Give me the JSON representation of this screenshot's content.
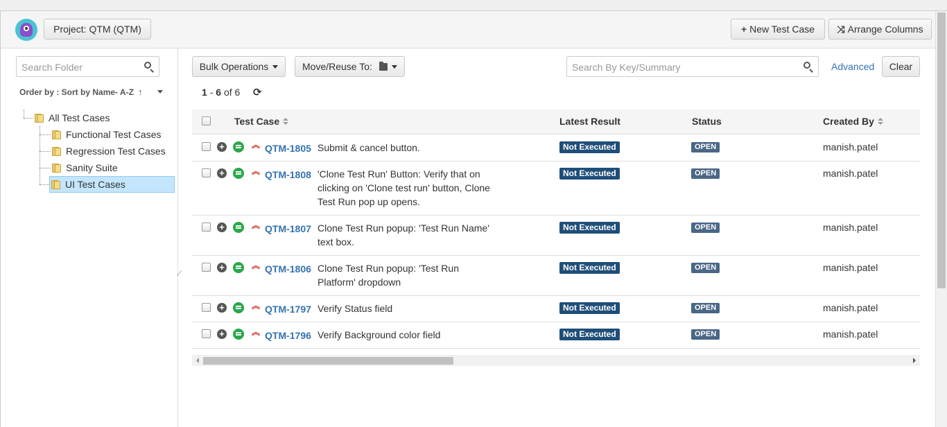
{
  "header": {
    "project_label": "Project:  QTM (QTM)",
    "new_test_case": "New Test Case",
    "arrange_columns": "Arrange Columns"
  },
  "sidebar": {
    "search_placeholder": "Search Folder",
    "order_by": "Order by : Sort by Name- A-Z",
    "tree": {
      "root": "All Test Cases",
      "children": [
        "Functional Test Cases",
        "Regression Test Cases",
        "Sanity Suite",
        "UI Test Cases"
      ],
      "selected": "UI Test Cases"
    }
  },
  "toolbar": {
    "bulk_operations": "Bulk Operations",
    "move_reuse": "Move/Reuse To:",
    "search_placeholder": "Search By Key/Summary",
    "advanced": "Advanced",
    "clear": "Clear"
  },
  "pager": {
    "start": "1",
    "end": "6",
    "total": "6"
  },
  "grid": {
    "columns": [
      "Test Case",
      "Latest Result",
      "Status",
      "Created By"
    ],
    "rows": [
      {
        "key": "QTM-1805",
        "summary": "Submit & cancel button.",
        "result": "Not Executed",
        "status": "OPEN",
        "created_by": "manish.patel"
      },
      {
        "key": "QTM-1808",
        "summary": "'Clone Test Run' Button: Verify that on clicking on 'Clone test run' button, Clone Test Run pop up opens.",
        "result": "Not Executed",
        "status": "OPEN",
        "created_by": "manish.patel"
      },
      {
        "key": "QTM-1807",
        "summary": "Clone Test Run popup: 'Test Run Name' text box.",
        "result": "Not Executed",
        "status": "OPEN",
        "created_by": "manish.patel"
      },
      {
        "key": "QTM-1806",
        "summary": "Clone Test Run popup: 'Test Run Platform' dropdown",
        "result": "Not Executed",
        "status": "OPEN",
        "created_by": "manish.patel"
      },
      {
        "key": "QTM-1797",
        "summary": "Verify Status field",
        "result": "Not Executed",
        "status": "OPEN",
        "created_by": "manish.patel"
      },
      {
        "key": "QTM-1796",
        "summary": "Verify Background color field",
        "result": "Not Executed",
        "status": "OPEN",
        "created_by": "manish.patel"
      }
    ]
  },
  "icons": {
    "new_test_case": "plus-icon",
    "arrange_columns": "shuffle-icon",
    "refresh": "refresh-icon",
    "row_add": "add-circle-icon",
    "row_run": "run-icon",
    "row_priority": "priority-high-icon"
  },
  "colors": {
    "link": "#3572b0",
    "not_executed": "#1f4e79",
    "open": "#4a6785",
    "priority": "#d04437",
    "run": "#2ba84a",
    "selected_folder": "#c4e6fc"
  }
}
